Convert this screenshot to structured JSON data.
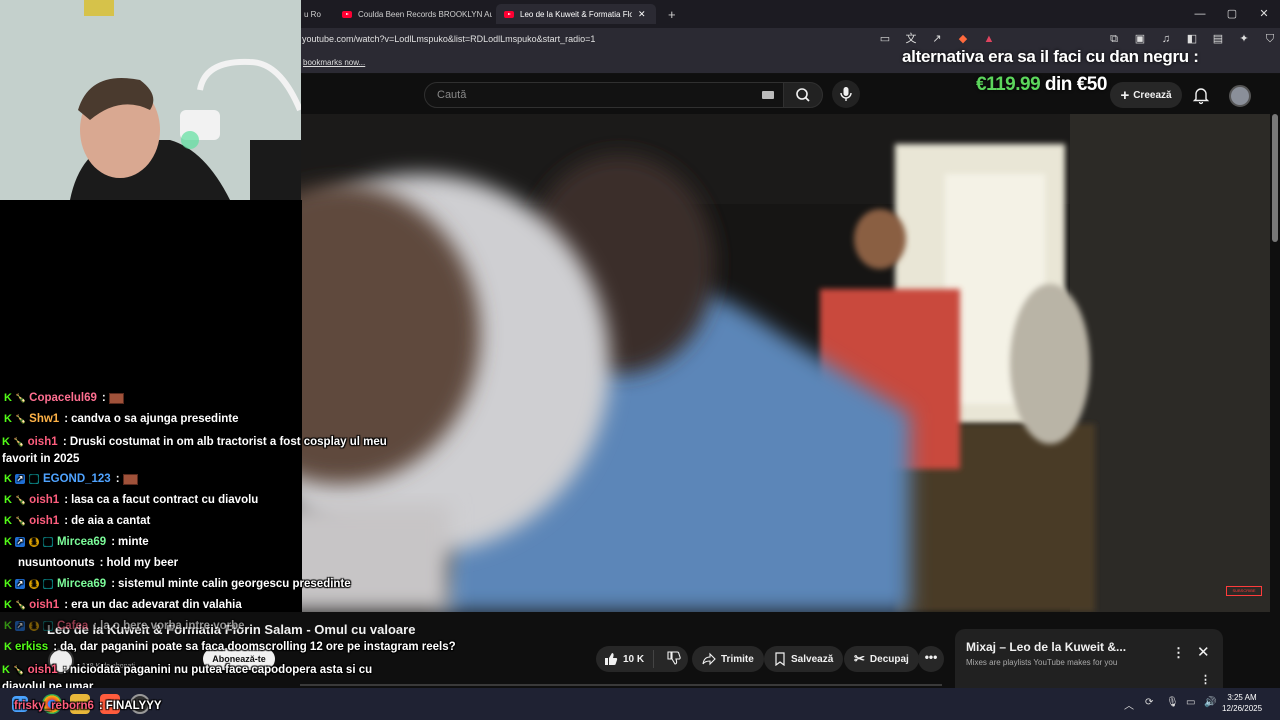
{
  "browser": {
    "tabs": [
      {
        "label": "Leo de la Kuweit & Formatia Flori",
        "active": true
      },
      {
        "label": "Coulda Been Records BROOKLYN Au",
        "active": false
      },
      {
        "label": "u Ro",
        "active": false
      }
    ],
    "new_tab": "+",
    "url": "youtube.com/watch?v=LodlLmspuko&list=RDLodlLmspuko&start_radio=1",
    "bookmarks_text": "bookmarks now...",
    "window_controls": [
      "—",
      "▢",
      "✕"
    ]
  },
  "youtube_header": {
    "search_placeholder": "Caută",
    "create_label": "Creează",
    "icons": [
      "search-icon",
      "microphone-icon",
      "bell-icon",
      "avatar"
    ]
  },
  "overlay": {
    "title": "alternativa era sa il faci cu dan negru :",
    "goal_current": "€119.99",
    "goal_rest": " din €50"
  },
  "video": {
    "watermark": "SUBSCRIBE",
    "title": "Leo de la Kuweit & Formatia Florin Salam - Omul cu valoare",
    "subscribers": "178 K de abonați",
    "subscribe_label": "Abonează-te",
    "likes": "10 K",
    "share_label": "Trimite",
    "save_label": "Salvează",
    "clip_label": "Decupaj",
    "more_label": "•••"
  },
  "mix_panel": {
    "title": "Mixaj – Leo de la Kuweit &...",
    "subtitle": "Mixes are playlists YouTube makes for you",
    "menu": "⋮",
    "close": "✕"
  },
  "chat": {
    "messages": [
      {
        "user": "Copacelul69",
        "color": "#ff6f91",
        "text": "",
        "emote": true,
        "badges": [
          "k",
          "bottle"
        ]
      },
      {
        "user": "Shw1",
        "color": "#ffb347",
        "text": "candva o sa ajunga presedinte",
        "badges": [
          "k",
          "bottle"
        ]
      },
      {
        "user": "oish1",
        "color": "#ff5e7e",
        "text": "Druski costumat in om alb tractorist a fost cosplay ul meu favorit in 2025",
        "badges": [
          "k",
          "bottle"
        ]
      },
      {
        "user": "EGOND_123",
        "color": "#4fa3ff",
        "text": "",
        "emote": true,
        "badges": [
          "k",
          "blue",
          "teal"
        ]
      },
      {
        "user": "oish1",
        "color": "#ff5e7e",
        "text": "lasa ca a facut contract cu diavolu",
        "badges": [
          "k",
          "bottle"
        ]
      },
      {
        "user": "oish1",
        "color": "#ff5e7e",
        "text": "de aia a cantat",
        "badges": [
          "k",
          "bottle"
        ]
      },
      {
        "user": "Mircea69",
        "color": "#7cfc9a",
        "text": "minte",
        "badges": [
          "k",
          "blue",
          "gold",
          "teal"
        ]
      },
      {
        "user": "nusuntoonuts",
        "color": "#ffffff",
        "text": "hold my beer",
        "badges": []
      },
      {
        "user": "Mircea69",
        "color": "#7cfc9a",
        "text": "sistemul minte calin georgescu presedinte",
        "badges": [
          "k",
          "blue",
          "gold",
          "teal"
        ]
      },
      {
        "user": "oish1",
        "color": "#ff5e7e",
        "text": "era un dac adevarat din valahia",
        "badges": [
          "k",
          "bottle"
        ]
      },
      {
        "user": "Cafea",
        "color": "#ff5e7e",
        "text": "la o bere vorba intre vorbe",
        "badges": [
          "k",
          "blue",
          "gold",
          "teal"
        ]
      },
      {
        "user": "erkiss",
        "color": "#53fc18",
        "text": "da, dar paganini poate sa faca doomscrolling 12 ore pe instagram reels?",
        "badges": []
      },
      {
        "user": "oish1",
        "color": "#ff5e7e",
        "text": "niciodata paganini nu putea face capodopera asta si cu diavolul pe umar",
        "badges": [
          "k",
          "bottle"
        ]
      },
      {
        "user": "frisky_reborn6",
        "color": "#ff5e7e",
        "text": "FINALYYY",
        "badges": []
      }
    ]
  },
  "taskbar": {
    "time": "3:25 AM",
    "date": "12/26/2025"
  }
}
